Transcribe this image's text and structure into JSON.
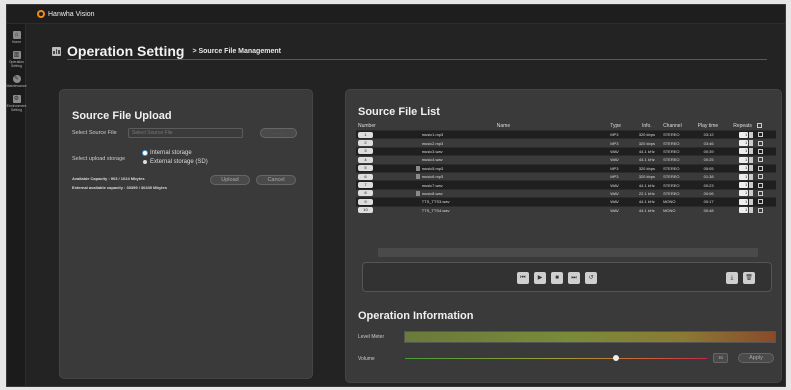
{
  "app": {
    "brand": "Hanwha Vision"
  },
  "sidebar": {
    "items": [
      {
        "label": "Home",
        "icon": "home-icon"
      },
      {
        "label": "Operation Setting",
        "icon": "chart-icon"
      },
      {
        "label": "Maintenance",
        "icon": "wrench-icon"
      },
      {
        "label": "Environment Setting",
        "icon": "settings-icon"
      }
    ]
  },
  "header": {
    "title": "Operation Setting",
    "breadcrumb": "> Source File Management"
  },
  "upload": {
    "title": "Source File Upload",
    "select_label": "Select Source File",
    "select_placeholder": "Select Source File",
    "browse_label": ". . . .",
    "storage_label": "Select upload storage",
    "storage_options": [
      "Internal storage",
      "External storage (SD)"
    ],
    "selected_storage": "Internal storage",
    "available_capacity": "Available Capacity : 903 / 1024 Mbytes",
    "external_capacity": "External available capacity : 30399 / 30430 Mbytes",
    "upload_button": "Upload",
    "cancel_button": "Cancel"
  },
  "list": {
    "title": "Source File List",
    "columns": [
      "Number",
      "Name",
      "Type",
      "Info.",
      "Channel",
      "Play time",
      "Repeats"
    ],
    "rows": [
      {
        "num": "1",
        "name": "music1.mp3",
        "type": "MP3",
        "info": "320 kbps",
        "channel": "STEREO",
        "time": "03:12",
        "repeats": "1",
        "locked": false
      },
      {
        "num": "2",
        "name": "music2.mp3",
        "type": "MP3",
        "info": "320 kbps",
        "channel": "STEREO",
        "time": "03:46",
        "repeats": "1",
        "locked": false
      },
      {
        "num": "3",
        "name": "music3.wav",
        "type": "WAV",
        "info": "44.1 kHz",
        "channel": "STEREO",
        "time": "00:39",
        "repeats": "1",
        "locked": false
      },
      {
        "num": "4",
        "name": "music4.wav",
        "type": "WAV",
        "info": "44.1 kHz",
        "channel": "STEREO",
        "time": "00:25",
        "repeats": "1",
        "locked": false
      },
      {
        "num": "5",
        "name": "music5.mp3",
        "type": "MP3",
        "info": "320 kbps",
        "channel": "STEREO",
        "time": "05:05",
        "repeats": "1",
        "locked": true
      },
      {
        "num": "6",
        "name": "music6.mp3",
        "type": "MP3",
        "info": "320 kbps",
        "channel": "STEREO",
        "time": "01:38",
        "repeats": "1",
        "locked": true
      },
      {
        "num": "7",
        "name": "music7.wav",
        "type": "WAV",
        "info": "44.1 kHz",
        "channel": "STEREO",
        "time": "00:23",
        "repeats": "1",
        "locked": false
      },
      {
        "num": "8",
        "name": "music8.wav",
        "type": "WAV",
        "info": "22.1 kHz",
        "channel": "STEREO",
        "time": "00:06",
        "repeats": "1",
        "locked": true
      },
      {
        "num": "9",
        "name": "TTS_TTS3.wav",
        "type": "WAV",
        "info": "44.1 kHz",
        "channel": "MONO",
        "time": "00:17",
        "repeats": "1",
        "locked": false
      },
      {
        "num": "10",
        "name": "TTS_TTS4.wav",
        "type": "WAV",
        "info": "44.1 kHz",
        "channel": "MONO",
        "time": "00:48",
        "repeats": "1",
        "locked": false
      }
    ]
  },
  "player": {
    "controls": [
      "skip-back-icon",
      "play-icon",
      "stop-icon",
      "skip-forward-icon",
      "repeat-icon"
    ],
    "download_icon": "download-icon",
    "delete_icon": "trash-icon"
  },
  "operation": {
    "title": "Operation Information",
    "level_label": "Level Meter",
    "volume_label": "Volume",
    "volume_value": "70",
    "volume_level_percent": 70,
    "apply_button": "Apply"
  }
}
